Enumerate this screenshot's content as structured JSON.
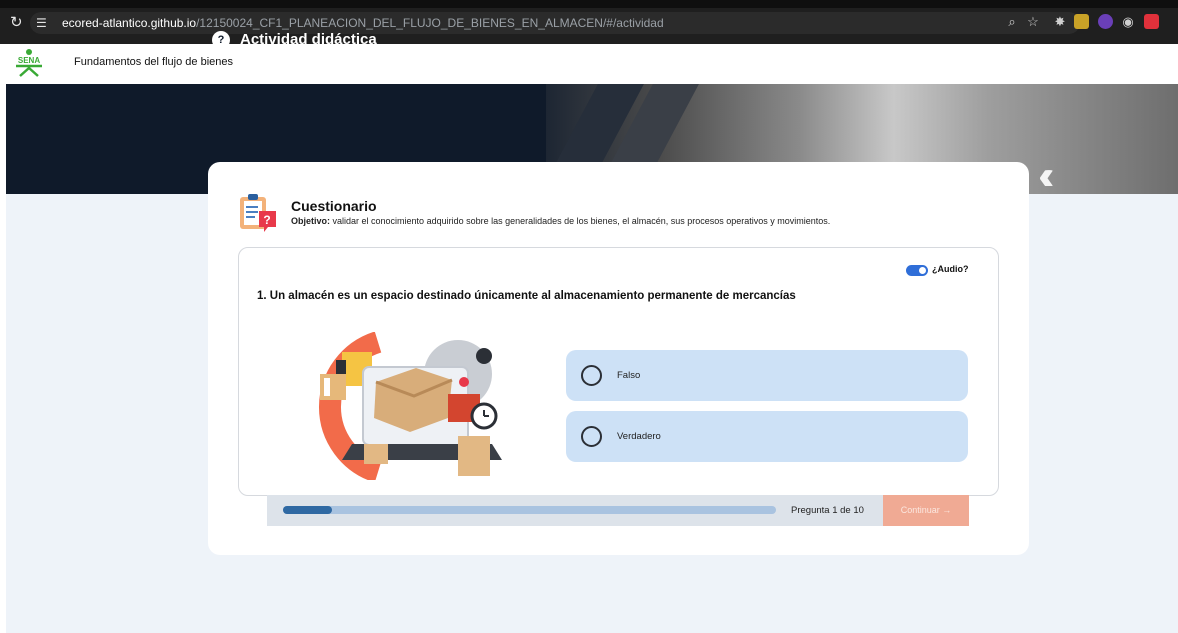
{
  "browser": {
    "url_host": "ecored-atlantico.github.io",
    "url_path": "/12150024_CF1_PLANEACION_DEL_FLUJO_DE_BIENES_EN_ALMACEN/#/actividad",
    "icons": [
      "reload-icon",
      "site-info-icon",
      "zoom-icon",
      "star-icon",
      "extension-icon"
    ]
  },
  "header": {
    "logo_text": "SENA",
    "course_title": "Fundamentos del flujo de bienes"
  },
  "banner": {
    "icon_glyph": "?",
    "title": "Actividad didáctica"
  },
  "quiz": {
    "title": "Cuestionario",
    "objective_label": "Objetivo:",
    "objective_text": " validar el conocimiento adquirido sobre las generalidades de los bienes, el almacén, sus procesos operativos y movimientos.",
    "audio_label": "¿Audio?",
    "audio_enabled": true,
    "question": "1. Un almacén es un espacio destinado únicamente al almacenamiento permanente de mercancías",
    "options": [
      {
        "label": "Falso"
      },
      {
        "label": "Verdadero"
      }
    ],
    "progress_fraction": 0.1,
    "progress_text": "Pregunta 1 de 10",
    "continue_label": "Continuar →"
  },
  "colors": {
    "accent_blue": "#2f6ed8",
    "option_bg": "#cde1f6",
    "progress_fill": "#2f69a3",
    "continue_bg": "#f0aa94",
    "banner_bg": "#0f1a2a",
    "sena_green": "#39a935"
  }
}
